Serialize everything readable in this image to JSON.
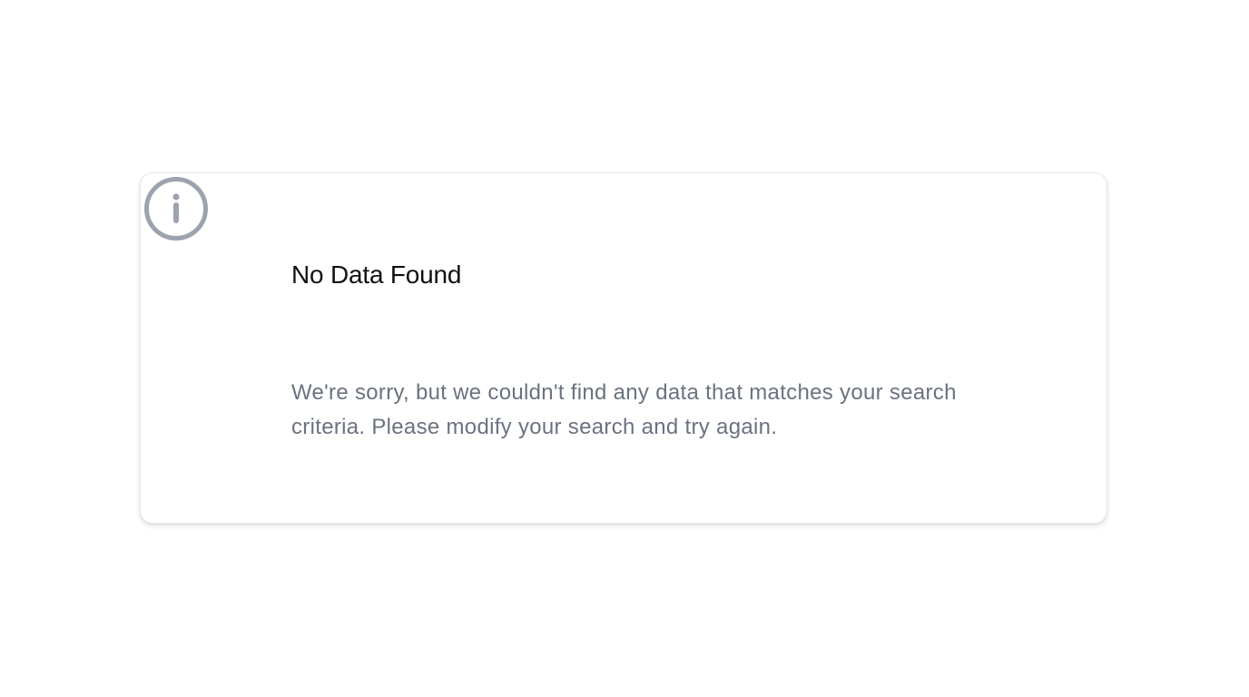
{
  "empty_state": {
    "icon": "info-icon",
    "title": "No Data Found",
    "message": "We're sorry, but we couldn't find any data that matches your search criteria. Please modify your search and try again."
  },
  "colors": {
    "icon": "#9ca3af",
    "title": "#111111",
    "message": "#6b7280",
    "card_border": "#e5e7eb",
    "background": "#ffffff"
  }
}
